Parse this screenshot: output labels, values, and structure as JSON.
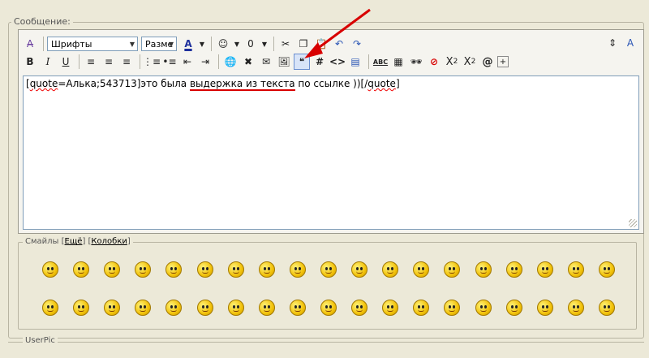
{
  "form": {
    "message_legend": "Сообщение:",
    "userpic_legend": "UserPic"
  },
  "toolbar": {
    "font_select": "Шрифты",
    "size_select": "Разме",
    "row1_icons": [
      "remove-format-icon",
      "font-color-icon",
      "smilies-icon",
      "attach-icon",
      "cut-icon",
      "copy-icon",
      "paste-icon",
      "undo-icon",
      "redo-icon"
    ],
    "row2_icons": [
      "bold-icon",
      "italic-icon",
      "underline-icon",
      "align-left-icon",
      "align-center-icon",
      "align-right-icon",
      "ordered-list-icon",
      "unordered-list-icon",
      "outdent-icon",
      "indent-icon",
      "link-icon",
      "unlink-icon",
      "email-icon",
      "image-icon",
      "quote-icon",
      "hash-icon",
      "code-icon",
      "php-icon",
      "spellcheck-icon",
      "table-icon",
      "spy-icon",
      "no-icon",
      "subscript-icon",
      "superscript-icon",
      "at-icon",
      "expand-icon"
    ],
    "subscript_label": "X",
    "subscript_sub": "2",
    "superscript_label": "X",
    "superscript_sup": "2",
    "at_label": "@",
    "bold_label": "B",
    "italic_label": "I",
    "underline_label": "U",
    "hash_label": "#",
    "code_label": "<>",
    "abc_label": "ABC"
  },
  "editor": {
    "text_before": "[",
    "quote_tag": "quote",
    "quote_attr": "=Алька;543713]это была ",
    "highlighted": "выдержка из текста",
    "text_after": " по ссылке ))[/",
    "closing_tag": "quote",
    "text_end": "]"
  },
  "smilies": {
    "legend_label": "Смайлы",
    "more_link": "Ещё",
    "kolobki_link": "Колобки",
    "count_row1": 19,
    "count_row2": 19
  },
  "annotation": {
    "arrow_color": "#d80000"
  }
}
